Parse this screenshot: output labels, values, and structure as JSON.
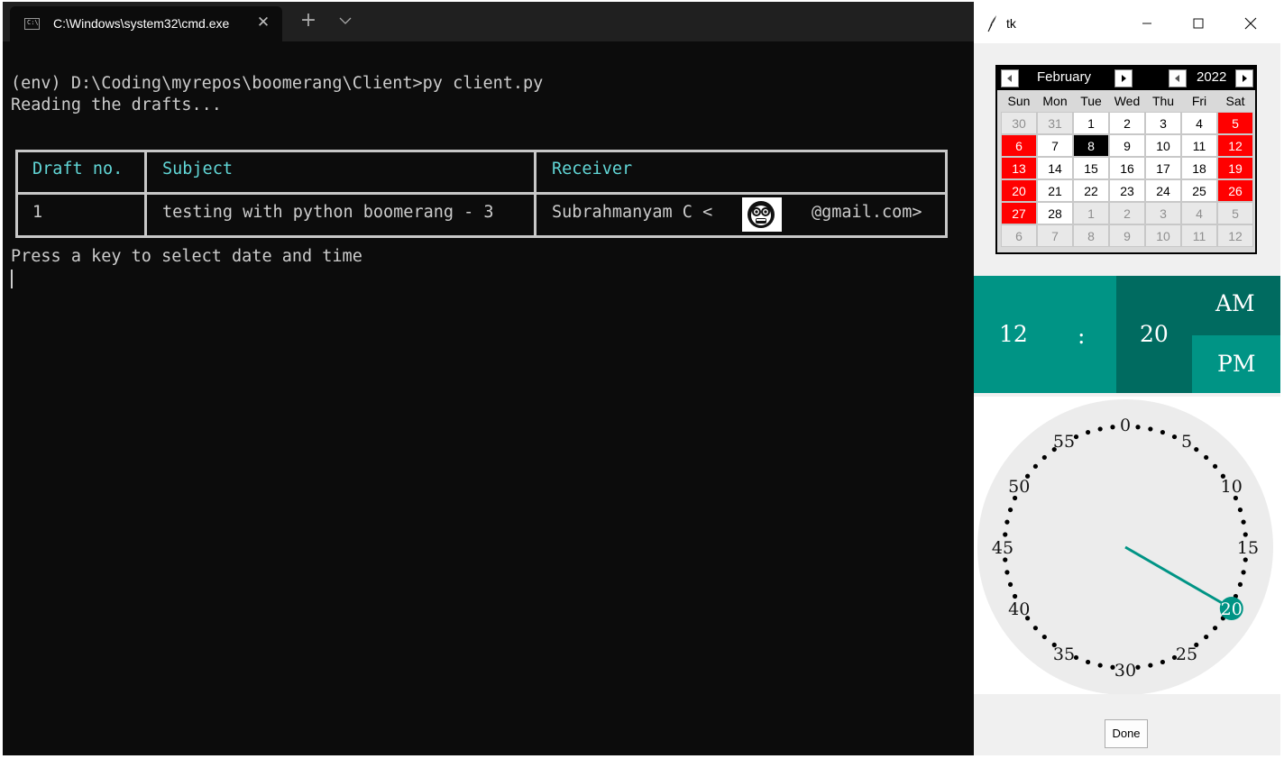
{
  "terminal": {
    "tab_title": "C:\\Windows\\system32\\cmd.exe",
    "icons": {
      "tab": "cmd-icon",
      "close": "close-icon",
      "new_tab": "plus-icon",
      "dropdown": "chevron-down-icon"
    },
    "lines": {
      "prompt": "(env) D:\\Coding\\myrepos\\boomerang\\Client>py client.py",
      "reading": "Reading the drafts...",
      "press": "Press a key to select date and time"
    },
    "table": {
      "headers": [
        "Draft no.",
        "Subject",
        "Receiver"
      ],
      "row": {
        "draft_no": "1",
        "subject": "testing with python boomerang - 3",
        "receiver_prefix": "Subrahmanyam C <",
        "receiver_suffix": "@gmail.com>"
      }
    },
    "colors": {
      "background": "#0c0c0c",
      "text": "#cccccc",
      "header_text": "#61d6d6"
    }
  },
  "tk": {
    "title": "tk",
    "icons": {
      "app": "feather-icon",
      "minimize": "minimize-icon",
      "maximize": "maximize-icon",
      "close": "close-icon"
    },
    "calendar": {
      "month": "February",
      "year": "2022",
      "weekdays": [
        "Sun",
        "Mon",
        "Tue",
        "Wed",
        "Thu",
        "Fri",
        "Sat"
      ],
      "weeks": [
        [
          "30",
          "31",
          "1",
          "2",
          "3",
          "4",
          "5"
        ],
        [
          "6",
          "7",
          "8",
          "9",
          "10",
          "11",
          "12"
        ],
        [
          "13",
          "14",
          "15",
          "16",
          "17",
          "18",
          "19"
        ],
        [
          "20",
          "21",
          "22",
          "23",
          "24",
          "25",
          "26"
        ],
        [
          "27",
          "28",
          "1",
          "2",
          "3",
          "4",
          "5"
        ],
        [
          "6",
          "7",
          "8",
          "9",
          "10",
          "11",
          "12"
        ]
      ],
      "selected_day": "8",
      "colors": {
        "weekend": "#ff0000",
        "selected": "#000000",
        "other_month_bg": "#e8e8e8",
        "other_month_text": "#8f8f8f"
      }
    },
    "time": {
      "hour": "12",
      "separator": ":",
      "minute": "20",
      "am": "AM",
      "pm": "PM"
    },
    "clock": {
      "labels": [
        "0",
        "5",
        "10",
        "15",
        "20",
        "25",
        "30",
        "35",
        "40",
        "45",
        "50",
        "55"
      ],
      "selected_minute": 20,
      "colors": {
        "face": "#ececec",
        "hand": "#009485"
      }
    },
    "done_label": "Done",
    "colors": {
      "teal": "#009485",
      "dark_teal": "#006b60"
    }
  }
}
